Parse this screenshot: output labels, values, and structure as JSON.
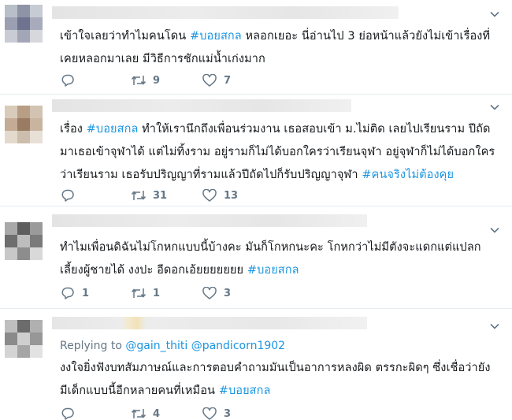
{
  "colors": {
    "text": "#14171a",
    "link": "#1b95e0",
    "muted": "#657786",
    "divider": "#e6ecf0"
  },
  "icons": {
    "reply": "reply-icon",
    "retweet": "retweet-icon",
    "like": "heart-icon",
    "menu": "chevron-down-icon"
  },
  "tweets": [
    {
      "lines": [
        [
          {
            "t": "เข้าใจเลยว่าทำไมคนโดน "
          },
          {
            "t": "#บอยสกล",
            "tag": true
          },
          {
            "t": " หลอกเยอะ  นี่อ่านไป 3 ย่อหน้าแล้วยังไม่เข้าเรื่องที่"
          }
        ],
        [
          {
            "t": "เคยหลอกมาเลย มีวิธีการชักแม่น้ำเก่งมาก"
          }
        ]
      ],
      "reply_count": "",
      "retweet_count": "9",
      "like_count": "7"
    },
    {
      "lines": [
        [
          {
            "t": "เรื่อง "
          },
          {
            "t": "#บอยสกล",
            "tag": true
          },
          {
            "t": " ทำให้เรานึกถึงเพื่อนร่วมงาน เธอสอบเข้า ม.ไม่ติด เลยไปเรียนราม ปีถัด"
          }
        ],
        [
          {
            "t": "มาเธอเข้าจุฬาได้ แต่ไม่ทิ้งราม อยู่รามก็ไม่ได้บอกใครว่าเรียนจุฬา อยู่จุฬาก็ไม่ได้บอกใคร"
          }
        ],
        [
          {
            "t": "ว่าเรียนราม เธอรับปริญญาที่รามแล้วปีถัดไปก็รับปริญญาจุฬา "
          },
          {
            "t": "#คนจริงไม่ต้องคุย",
            "tag": true
          }
        ]
      ],
      "reply_count": "",
      "retweet_count": "31",
      "like_count": "13"
    },
    {
      "lines": [
        [
          {
            "t": "ทำไมเพื่อนดิฉันไม่โกหกแบบนี้บ้างคะ มันก็โกหกนะคะ โกหกว่าไม่มีตังจะแดกแต่แปลก"
          }
        ],
        [
          {
            "t": "เลี้ยงผู้ชายได้ งงปะ อีดอกเอ้ยยยยยยย "
          },
          {
            "t": "#บอยสกล",
            "tag": true
          }
        ]
      ],
      "reply_count": "1",
      "retweet_count": "1",
      "like_count": "3"
    },
    {
      "replying_label": "Replying to",
      "replying_mentions": "@gain_thiti @pandicorn1902",
      "lines": [
        [
          {
            "t": "งงใจยิ่งฟังบทสัมภาษณ์และการตอบคำถามมันเป็นอาการหลงผิด ตรรกะผิดๆ ซึ่งเชื่อว่ายัง"
          }
        ],
        [
          {
            "t": "มีเด็กแบบนี้อีกหลายคนที่เหมือน "
          },
          {
            "t": "#บอยสกล",
            "tag": true
          }
        ]
      ],
      "reply_count": "",
      "retweet_count": "4",
      "like_count": "3"
    }
  ]
}
